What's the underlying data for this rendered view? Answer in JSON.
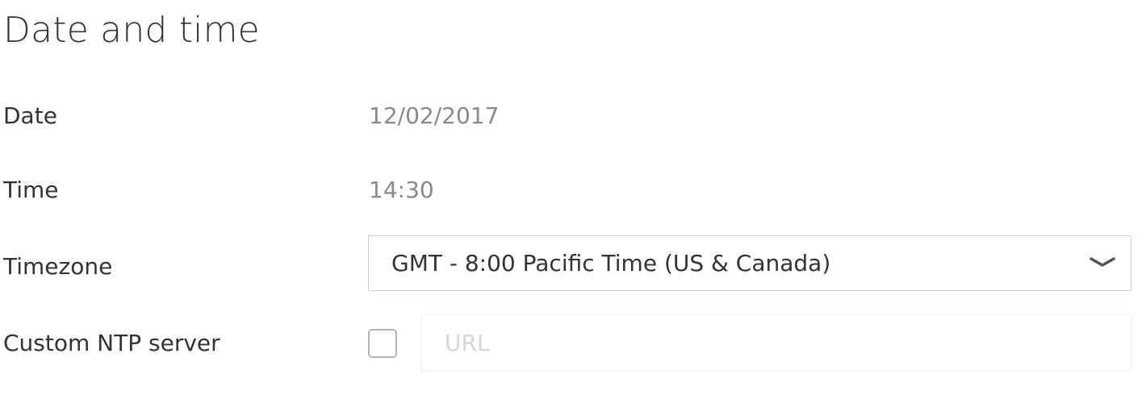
{
  "page": {
    "title": "Date and time"
  },
  "rows": {
    "date": {
      "label": "Date",
      "value": "12/02/2017"
    },
    "time": {
      "label": "Time",
      "value": "14:30"
    },
    "timezone": {
      "label": "Timezone",
      "selected": "GMT - 8:00 Pacific Time (US & Canada)",
      "icon": "chevron-down-icon"
    },
    "ntp": {
      "label": "Custom NTP server",
      "checked": false,
      "url_value": "",
      "url_placeholder": "URL"
    }
  },
  "colors": {
    "text": "#333333",
    "muted": "#8a8a8a",
    "border": "#cdcdcd",
    "placeholder": "#d6d6d6"
  }
}
